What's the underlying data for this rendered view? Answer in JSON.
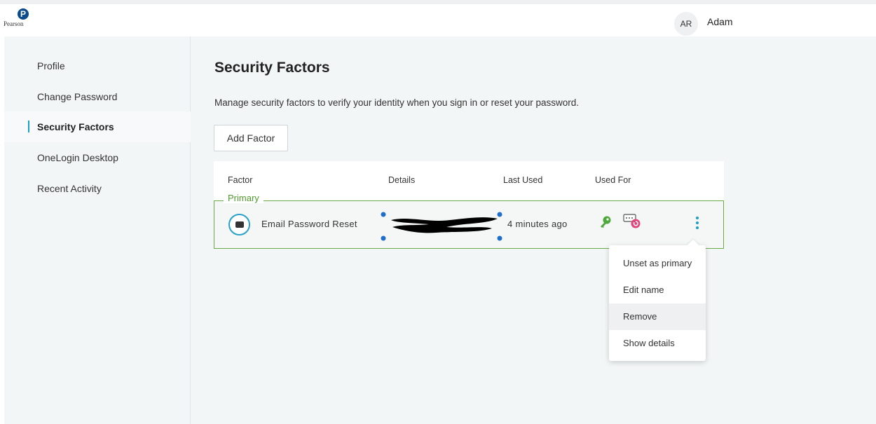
{
  "header": {
    "brand": "Pearson",
    "brand_mark": "P",
    "user_initials": "AR",
    "user_name": "Adam"
  },
  "sidebar": {
    "items": [
      {
        "label": "Profile"
      },
      {
        "label": "Change Password"
      },
      {
        "label": "Security Factors",
        "active": true
      },
      {
        "label": "OneLogin Desktop"
      },
      {
        "label": "Recent Activity"
      }
    ]
  },
  "main": {
    "title": "Security Factors",
    "description": "Manage security factors to verify your identity when you sign in or reset your password.",
    "add_button": "Add Factor",
    "table": {
      "columns": [
        "Factor",
        "Details",
        "Last Used",
        "Used For"
      ],
      "rows": [
        {
          "group_label": "Primary",
          "factor": "Email Password Reset",
          "factor_icon": "envelope-icon",
          "details": "",
          "details_redacted": true,
          "last_used": "4 minutes ago",
          "used_for_icons": [
            "key-icon",
            "password-reset-icon"
          ]
        }
      ]
    }
  },
  "menu": {
    "items": [
      "Unset as primary",
      "Edit name",
      "Remove",
      "Show details"
    ],
    "hovered": "Remove"
  },
  "colors": {
    "accent": "#1aa0c8",
    "primary_border": "#6aaa48",
    "primary_text": "#4f9b2d",
    "key_icon": "#4fa83a",
    "reset_icon": "#e0457b"
  }
}
